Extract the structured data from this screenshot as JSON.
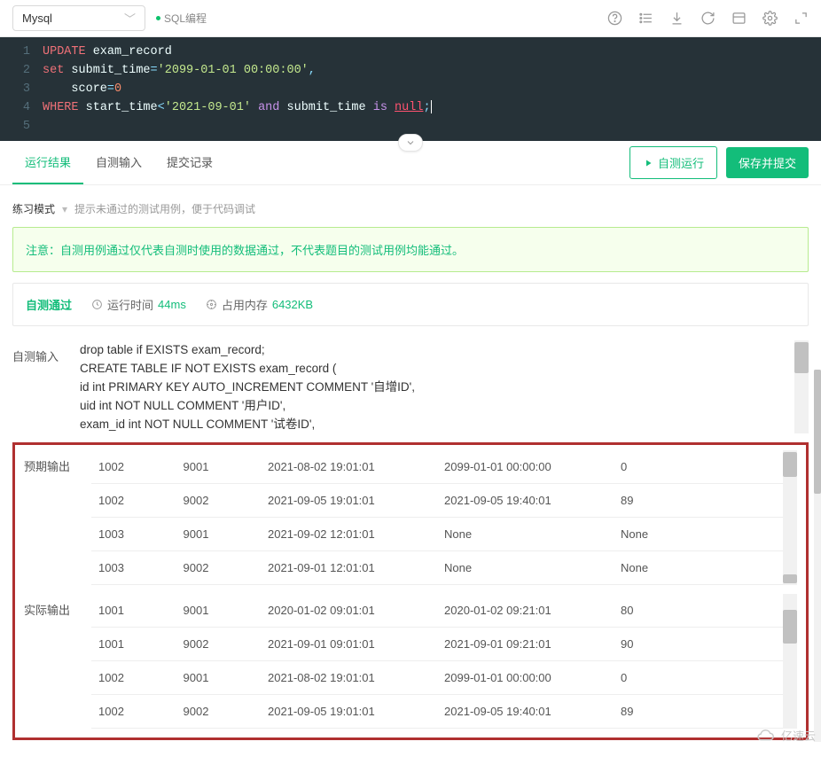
{
  "toolbar": {
    "language": "Mysql",
    "sql_label": "SQL编程",
    "icons": [
      "help-icon",
      "list-icon",
      "download-icon",
      "refresh-icon",
      "save-icon",
      "settings-icon",
      "expand-icon"
    ]
  },
  "code": {
    "lines": [
      [
        {
          "t": "UPDATE",
          "c": "tok-kw"
        },
        {
          "t": " exam_record",
          "c": "tok-id"
        }
      ],
      [
        {
          "t": "set",
          "c": "tok-kw"
        },
        {
          "t": " submit_time",
          "c": "tok-id"
        },
        {
          "t": "=",
          "c": "tok-op"
        },
        {
          "t": "'2099-01-01 00:00:00'",
          "c": "tok-str"
        },
        {
          "t": ",",
          "c": "tok-op"
        }
      ],
      [
        {
          "t": "    score",
          "c": "tok-id"
        },
        {
          "t": "=",
          "c": "tok-op"
        },
        {
          "t": "0",
          "c": "tok-num"
        }
      ],
      [
        {
          "t": "WHERE",
          "c": "tok-kw"
        },
        {
          "t": " start_time",
          "c": "tok-id"
        },
        {
          "t": "<",
          "c": "tok-op"
        },
        {
          "t": "'2021-09-01'",
          "c": "tok-str"
        },
        {
          "t": " ",
          "c": ""
        },
        {
          "t": "and",
          "c": "tok-kw2"
        },
        {
          "t": " submit_time ",
          "c": "tok-id"
        },
        {
          "t": "is",
          "c": "tok-kw2"
        },
        {
          "t": " ",
          "c": ""
        },
        {
          "t": "null",
          "c": "tok-null"
        },
        {
          "t": ";",
          "c": "tok-op"
        }
      ],
      [
        {
          "t": "",
          "c": ""
        }
      ]
    ]
  },
  "tabs": {
    "run_result": "运行结果",
    "self_input": "自测输入",
    "submit_history": "提交记录"
  },
  "buttons": {
    "self_run": "自测运行",
    "submit": "保存并提交"
  },
  "mode": {
    "label": "练习模式",
    "hint": "提示未通过的测试用例，便于代码调试"
  },
  "notice": "注意：自测用例通过仅代表自测时使用的数据通过，不代表题目的测试用例均能通过。",
  "pass": {
    "label": "自测通过",
    "runtime_label": "运行时间",
    "runtime_value": "44ms",
    "memory_label": "占用内存",
    "memory_value": "6432KB"
  },
  "sections": {
    "self_input_label": "自测输入",
    "expected_label": "预期输出",
    "actual_label": "实际输出",
    "self_input_sql": [
      "drop table if EXISTS exam_record;",
      "CREATE TABLE IF NOT EXISTS exam_record (",
      "id int PRIMARY KEY AUTO_INCREMENT COMMENT '自增ID',",
      "uid int NOT NULL COMMENT '用户ID',",
      "exam_id int NOT NULL COMMENT '试卷ID',"
    ],
    "expected_rows": [
      [
        "1002",
        "9001",
        "2021-08-02 19:01:01",
        "2099-01-01 00:00:00",
        "0"
      ],
      [
        "1002",
        "9002",
        "2021-09-05 19:01:01",
        "2021-09-05 19:40:01",
        "89"
      ],
      [
        "1003",
        "9001",
        "2021-09-02 12:01:01",
        "None",
        "None"
      ],
      [
        "1003",
        "9002",
        "2021-09-01 12:01:01",
        "None",
        "None"
      ]
    ],
    "actual_rows": [
      [
        "1001",
        "9001",
        "2020-01-02 09:01:01",
        "2020-01-02 09:21:01",
        "80"
      ],
      [
        "1001",
        "9002",
        "2021-09-01 09:01:01",
        "2021-09-01 09:21:01",
        "90"
      ],
      [
        "1002",
        "9001",
        "2021-08-02 19:01:01",
        "2099-01-01 00:00:00",
        "0"
      ],
      [
        "1002",
        "9002",
        "2021-09-05 19:01:01",
        "2021-09-05 19:40:01",
        "89"
      ]
    ]
  },
  "watermark": "亿速云"
}
